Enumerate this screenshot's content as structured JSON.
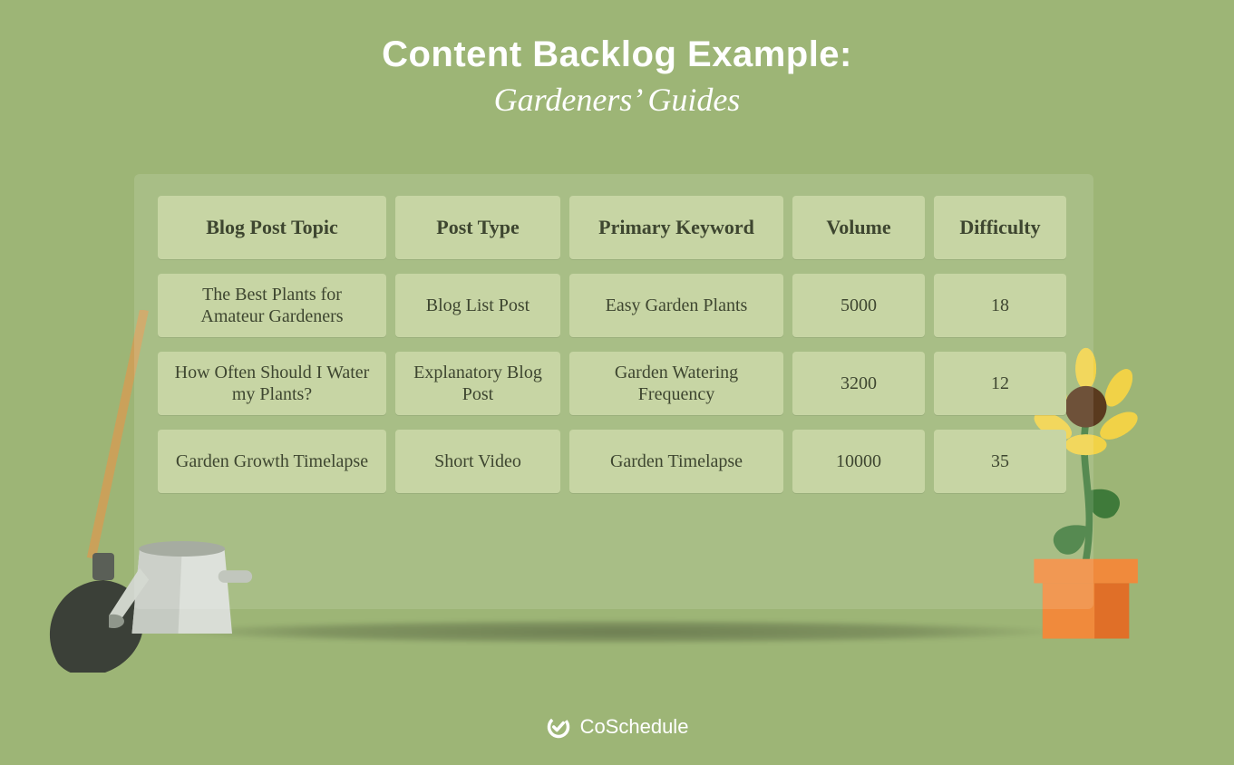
{
  "title_line1": "Content Backlog Example:",
  "title_line2": "Gardeners’ Guides",
  "brand": "CoSchedule",
  "chart_data": {
    "type": "table",
    "columns": [
      "Blog Post Topic",
      "Post Type",
      "Primary Keyword",
      "Volume",
      "Difficulty"
    ],
    "rows": [
      {
        "topic": "The Best Plants for Amateur Gardeners",
        "post_type": "Blog List Post",
        "keyword": "Easy Garden Plants",
        "volume": 5000,
        "difficulty": 18
      },
      {
        "topic": "How Often Should I Water my Plants?",
        "post_type": "Explanatory Blog Post",
        "keyword": "Garden Watering Frequency",
        "volume": 3200,
        "difficulty": 12
      },
      {
        "topic": "Garden Growth Timelapse",
        "post_type": "Short Video",
        "keyword": "Garden Timelapse",
        "volume": 10000,
        "difficulty": 35
      }
    ]
  }
}
